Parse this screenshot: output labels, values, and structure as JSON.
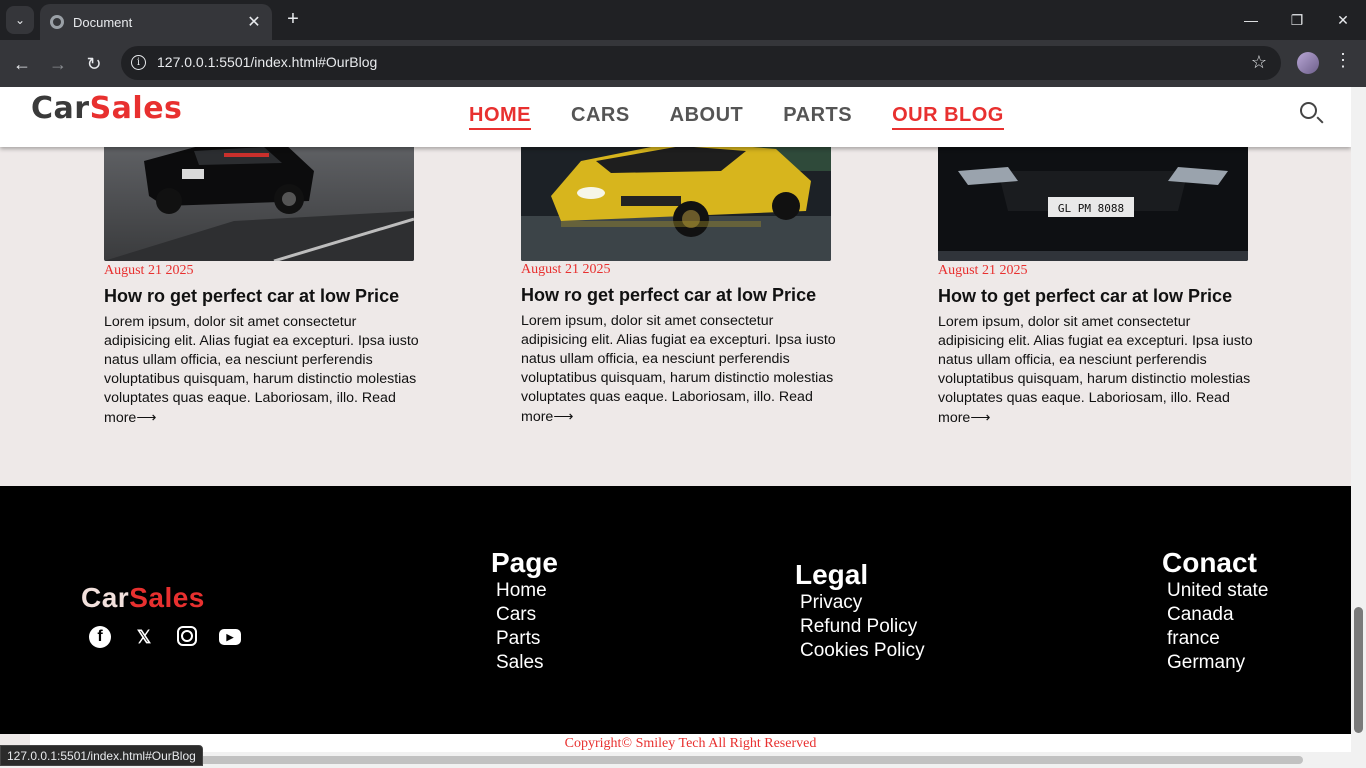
{
  "browser": {
    "tab_title": "Document",
    "url": "127.0.0.1:5501/index.html#OurBlog",
    "status_url": "127.0.0.1:5501/index.html#OurBlog"
  },
  "header": {
    "logo_part1": "Car",
    "logo_part2": "Sales",
    "nav": [
      "HOME",
      "CARS",
      "ABOUT",
      "PARTS",
      "OUR BLOG"
    ],
    "active_nav": [
      "HOME",
      "OUR BLOG"
    ]
  },
  "blog": {
    "cards": [
      {
        "date": "August 21 2025",
        "title": "How ro get perfect car at low Price",
        "text": "Lorem ipsum, dolor sit amet consectetur adipisicing elit. Alias fugiat ea excepturi. Ipsa iusto natus ullam officia, ea nesciunt perferendis voluptatibus quisquam, harum distinctio molestias voluptates quas eaque. Laboriosam, illo.",
        "link": "Read more",
        "image": "black-sports-car"
      },
      {
        "date": "August 21 2025",
        "title": "How ro get perfect car at low Price",
        "text": "Lorem ipsum, dolor sit amet consectetur adipisicing elit. Alias fugiat ea excepturi. Ipsa iusto natus ullam officia, ea nesciunt perferendis voluptatibus quisquam, harum distinctio molestias voluptates quas eaque. Laboriosam, illo.",
        "link": "Read more",
        "image": "yellow-sedan"
      },
      {
        "date": "August 21 2025",
        "title": "How to get perfect car at low Price",
        "text": "Lorem ipsum, dolor sit amet consectetur adipisicing elit. Alias fugiat ea excepturi. Ipsa iusto natus ullam officia, ea nesciunt perferendis voluptatibus quisquam, harum distinctio molestias voluptates quas eaque. Laboriosam, illo.",
        "link": "Read more",
        "image": "black-audi",
        "plate": "GL PM 8088"
      }
    ]
  },
  "footer": {
    "logo_part1": "Car",
    "logo_part2": "Sales",
    "socials": [
      "facebook-icon",
      "x-icon",
      "instagram-icon",
      "youtube-icon"
    ],
    "page": {
      "heading": "Page",
      "items": [
        "Home",
        "Cars",
        "Parts",
        "Sales"
      ]
    },
    "legal": {
      "heading": "Legal",
      "items": [
        "Privacy",
        "Refund Policy",
        "Cookies Policy"
      ]
    },
    "contact": {
      "heading": "Conact",
      "items": [
        "United state",
        "Canada",
        "france",
        "Germany"
      ]
    },
    "copyright": "Copyright© Smiley Tech All Right Reserved"
  },
  "colors": {
    "accent": "#e8302f",
    "page_bg": "#eee9e8",
    "footer_bg": "#000000"
  }
}
